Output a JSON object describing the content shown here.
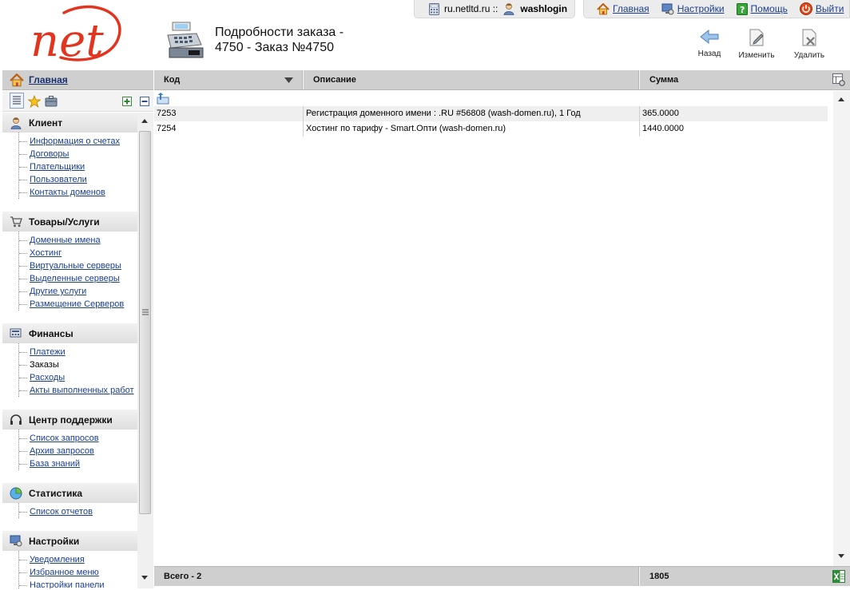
{
  "header": {
    "logo_text": "net",
    "site": "ru.netltd.ru ::",
    "username": "washlogin",
    "links": {
      "home": "Главная",
      "settings": "Настройки",
      "help": "Помощь",
      "logout": "Выйти"
    },
    "page_title_line1": "Подробности заказа -",
    "page_title_line2": "4750 - Заказ №4750",
    "toolbar": {
      "back": "Назад",
      "edit": "Изменить",
      "delete": "Удалить"
    }
  },
  "sidebar": {
    "home_label": "Главная",
    "groups": [
      {
        "title": "Клиент",
        "icon": "user-icon",
        "items": [
          "Информация о счетах",
          "Договоры",
          "Плательщики",
          "Пользователи",
          "Контакты доменов"
        ]
      },
      {
        "title": "Товары/Услуги",
        "icon": "cart-icon",
        "items": [
          "Доменные имена",
          "Хостинг",
          "Виртуальные серверы",
          "Выделенные серверы",
          "Другие услуги",
          "Размещение Серверов"
        ]
      },
      {
        "title": "Финансы",
        "icon": "finance-icon",
        "items": [
          "Платежи",
          "Заказы",
          "Расходы",
          "Акты выполненных работ"
        ]
      },
      {
        "title": "Центр поддержки",
        "icon": "headset-icon",
        "items": [
          "Список запросов",
          "Архив запросов",
          "База знаний"
        ]
      },
      {
        "title": "Статистика",
        "icon": "pie-chart-icon",
        "items": [
          "Список отчетов"
        ]
      },
      {
        "title": "Настройки",
        "icon": "monitor-icon",
        "items": [
          "Уведомления",
          "Избранное меню",
          "Настройки панели"
        ]
      }
    ]
  },
  "table": {
    "columns": {
      "code": "Код",
      "description": "Описание",
      "sum": "Сумма"
    },
    "rows": [
      {
        "code": "7253",
        "description": "Регистрация доменного имени : .RU #56808 (wash-domen.ru), 1 Год",
        "sum": "365.0000"
      },
      {
        "code": "7254",
        "description": "Хостинг по тарифу - Smart.Опти (wash-domen.ru)",
        "sum": "1440.0000"
      }
    ],
    "footer": {
      "total_label": "Всего - 2",
      "total_sum": "1805"
    }
  },
  "colors": {
    "logo_red": "#e2341f",
    "link_blue": "#1a3e8c",
    "header_grey": "#cfcfcf",
    "stripe": "#efefef"
  }
}
